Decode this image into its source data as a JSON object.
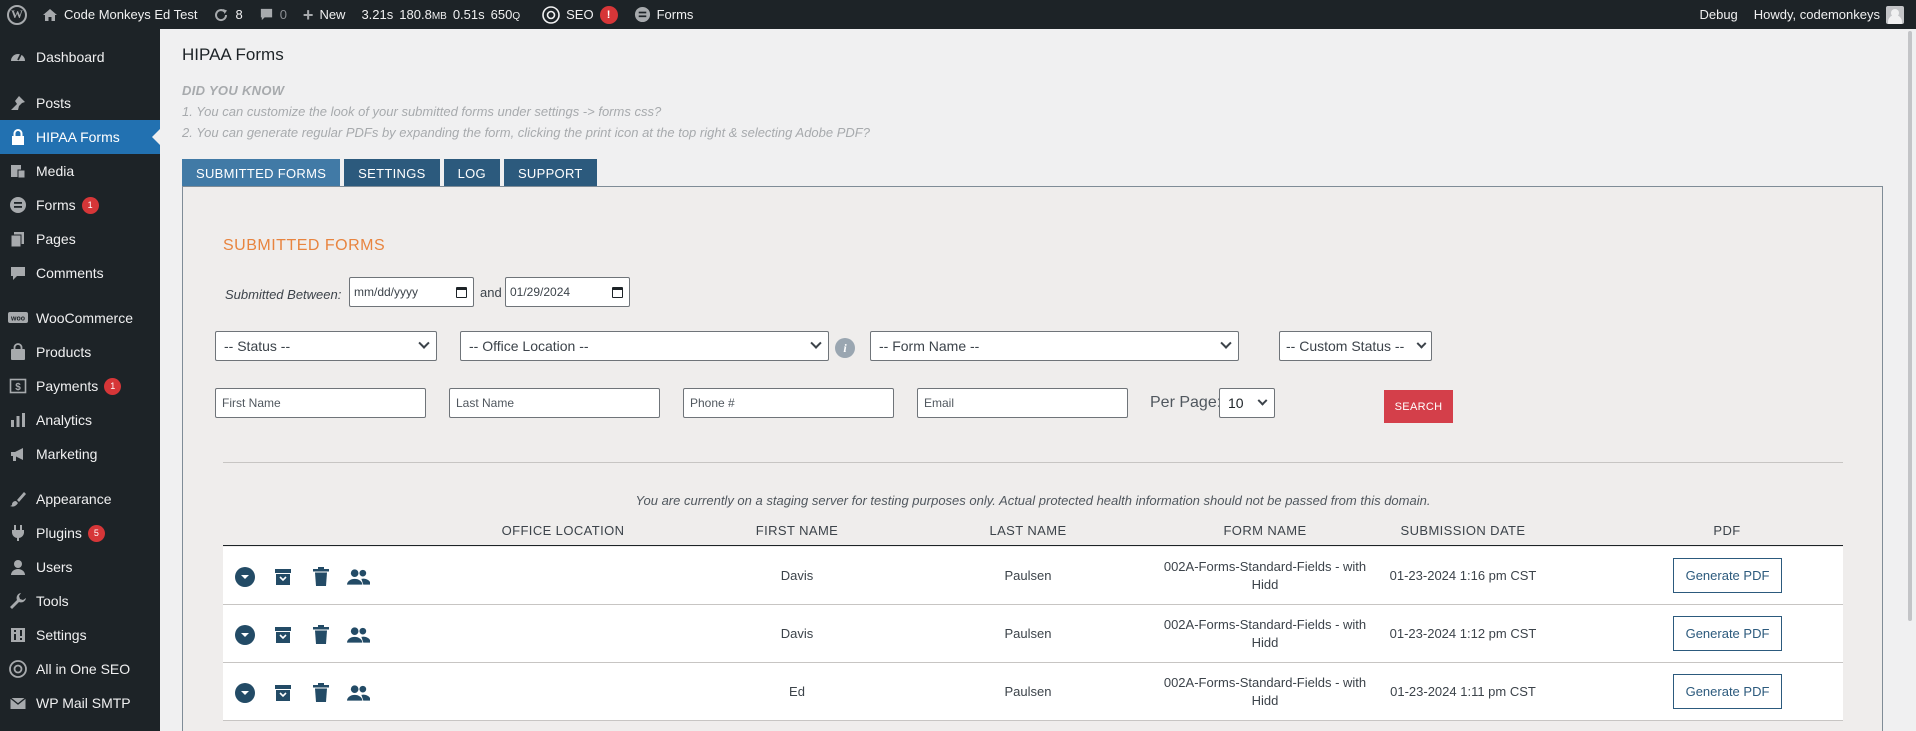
{
  "adminbar": {
    "site_name": "Code Monkeys Ed Test",
    "updates_count": "8",
    "comments_count": "0",
    "new_label": "New",
    "stat_time": "3.21s",
    "stat_mem": "180.8",
    "stat_mem_unit": "MB",
    "stat_query_time": "0.51s",
    "stat_queries": "650",
    "stat_queries_unit": "Q",
    "seo_label": "SEO",
    "seo_badge": "!",
    "forms_label": "Forms",
    "debug_label": "Debug",
    "howdy_label": "Howdy, codemonkeys"
  },
  "sidebar": {
    "items": [
      {
        "label": "Dashboard",
        "icon": "dashboard-icon",
        "badge": ""
      },
      {
        "label": "Posts",
        "icon": "pin-icon",
        "badge": ""
      },
      {
        "label": "HIPAA Forms",
        "icon": "lock-icon",
        "badge": ""
      },
      {
        "label": "Media",
        "icon": "media-icon",
        "badge": ""
      },
      {
        "label": "Forms",
        "icon": "forms-icon",
        "badge": "1"
      },
      {
        "label": "Pages",
        "icon": "pages-icon",
        "badge": ""
      },
      {
        "label": "Comments",
        "icon": "comment-icon",
        "badge": ""
      },
      {
        "label": "WooCommerce",
        "icon": "woo-icon",
        "badge": ""
      },
      {
        "label": "Products",
        "icon": "bag-icon",
        "badge": ""
      },
      {
        "label": "Payments",
        "icon": "dollar-icon",
        "badge": "1"
      },
      {
        "label": "Analytics",
        "icon": "bar-chart-icon",
        "badge": ""
      },
      {
        "label": "Marketing",
        "icon": "megaphone-icon",
        "badge": ""
      },
      {
        "label": "Appearance",
        "icon": "brush-icon",
        "badge": ""
      },
      {
        "label": "Plugins",
        "icon": "plug-icon",
        "badge": "5"
      },
      {
        "label": "Users",
        "icon": "user-icon",
        "badge": ""
      },
      {
        "label": "Tools",
        "icon": "wrench-icon",
        "badge": ""
      },
      {
        "label": "Settings",
        "icon": "settings-icon",
        "badge": ""
      },
      {
        "label": "All in One SEO",
        "icon": "aioseo-icon",
        "badge": ""
      },
      {
        "label": "WP Mail SMTP",
        "icon": "mail-icon",
        "badge": ""
      }
    ],
    "active": "HIPAA Forms"
  },
  "page": {
    "title": "HIPAA Forms",
    "dyk_title": "DID YOU KNOW",
    "dyk_1": "1. You can customize the look of your submitted forms under settings -> forms css?",
    "dyk_2": "2. You can generate regular PDFs by expanding the form, clicking the print icon at the top right & selecting Adobe PDF?"
  },
  "tabs": [
    "SUBMITTED FORMS",
    "SETTINGS",
    "LOG",
    "SUPPORT"
  ],
  "filters": {
    "section_title": "SUBMITTED FORMS",
    "submitted_between": "Submitted Between:",
    "date_from": "mm/dd/yyyy",
    "and_label": "and",
    "date_to": "01/29/2024",
    "status": "-- Status --",
    "office_location": "-- Office Location --",
    "form_name": "-- Form Name --",
    "custom_status": "-- Custom Status --",
    "first_name_ph": "First Name",
    "last_name_ph": "Last Name",
    "phone_ph": "Phone #",
    "email_ph": "Email",
    "per_page_label": "Per Page:",
    "per_page_value": "10",
    "search_label": "SEARCH"
  },
  "staging_note": "You are currently on a staging server for testing purposes only. Actual protected health information should not be passed from this domain.",
  "table": {
    "headers": [
      "OFFICE LOCATION",
      "FIRST NAME",
      "LAST NAME",
      "FORM NAME",
      "SUBMISSION DATE",
      "PDF"
    ],
    "rows": [
      {
        "office": "",
        "first": "Davis",
        "last": "Paulsen",
        "form_name": "002A-Forms-Standard-Fields - with Hidd",
        "date": "01-23-2024 1:16 pm CST",
        "pdf": "Generate PDF"
      },
      {
        "office": "",
        "first": "Davis",
        "last": "Paulsen",
        "form_name": "002A-Forms-Standard-Fields - with Hidd",
        "date": "01-23-2024 1:12 pm CST",
        "pdf": "Generate PDF"
      },
      {
        "office": "",
        "first": "Ed",
        "last": "Paulsen",
        "form_name": "002A-Forms-Standard-Fields - with Hidd",
        "date": "01-23-2024 1:11 pm CST",
        "pdf": "Generate PDF"
      }
    ]
  },
  "colors": {
    "adminbar_bg": "#1d2327",
    "active_menu": "#2271b1",
    "tab_bg": "#2c5a7d",
    "section_title": "#e8843f",
    "search_btn": "#d43f4a",
    "badge": "#d63638"
  }
}
